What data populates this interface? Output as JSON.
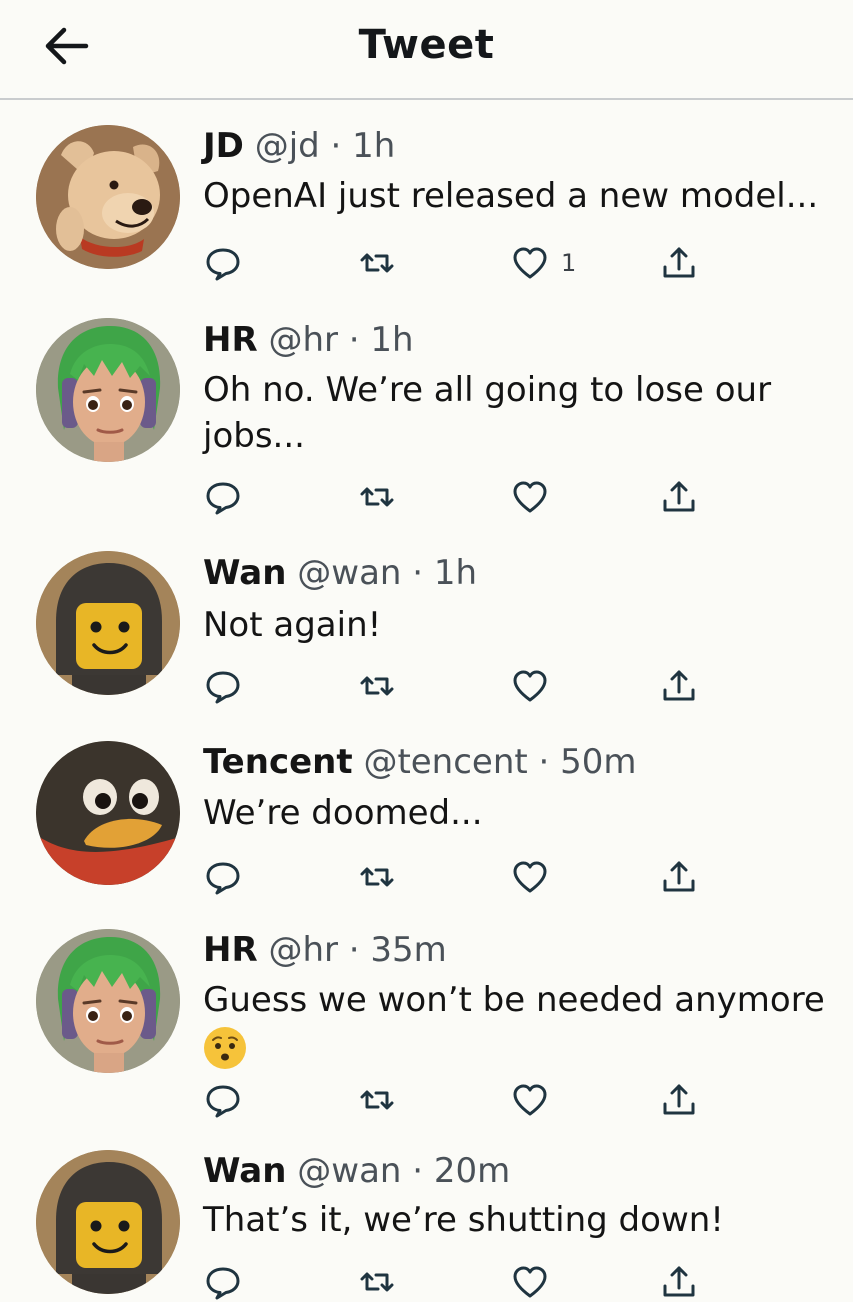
{
  "header": {
    "title": "Tweet",
    "back_icon": "arrow-left-icon"
  },
  "colors": {
    "background": "#fbfbf7",
    "text": "#141414",
    "secondary_text": "#4a5158",
    "icon": "#1f3440"
  },
  "tweets": [
    {
      "name": "JD",
      "handle": "@jd",
      "time": "1h",
      "text": "OpenAI just released a new model...",
      "like_count": "1",
      "avatar": "dog-avatar"
    },
    {
      "name": "HR",
      "handle": "@hr",
      "time": "1h",
      "text": "Oh no. We’re all going to lose our jobs...",
      "like_count": "",
      "avatar": "green-hair-person-avatar"
    },
    {
      "name": "Wan",
      "handle": "@wan",
      "time": "1h",
      "text": "Not again!",
      "like_count": "",
      "avatar": "helmet-figure-avatar"
    },
    {
      "name": "Tencent",
      "handle": "@tencent",
      "time": "50m",
      "text": "We’re doomed...",
      "like_count": "",
      "avatar": "penguin-avatar"
    },
    {
      "name": "HR",
      "handle": "@hr",
      "time": "35m",
      "text": "Guess we won’t be needed anymore",
      "emoji": "worried-face-emoji",
      "like_count": "",
      "avatar": "green-hair-person-avatar"
    },
    {
      "name": "Wan",
      "handle": "@wan",
      "time": "20m",
      "text": "That’s it, we’re shutting down!",
      "like_count": "",
      "avatar": "helmet-figure-avatar"
    }
  ],
  "action_icons": [
    "reply-icon",
    "retweet-icon",
    "like-icon",
    "share-icon"
  ]
}
